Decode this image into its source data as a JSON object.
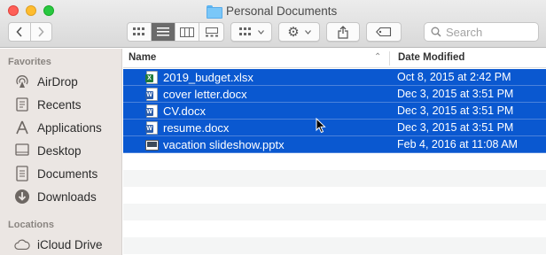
{
  "window": {
    "title": "Personal Documents"
  },
  "toolbar": {
    "back_icon": "chevron-left-icon",
    "forward_icon": "chevron-right-icon",
    "view_modes": [
      "icon-view-icon",
      "list-view-icon",
      "column-view-icon",
      "gallery-view-icon"
    ],
    "active_view": 1,
    "group_icon": "group-by-icon",
    "action_icon": "gear-icon",
    "share_icon": "share-icon",
    "tag_icon": "tag-icon",
    "search_placeholder": "Search"
  },
  "sidebar": {
    "favorites_label": "Favorites",
    "favorites": [
      {
        "label": "AirDrop",
        "icon": "airdrop-icon"
      },
      {
        "label": "Recents",
        "icon": "recents-icon"
      },
      {
        "label": "Applications",
        "icon": "applications-icon"
      },
      {
        "label": "Desktop",
        "icon": "desktop-icon"
      },
      {
        "label": "Documents",
        "icon": "documents-icon"
      },
      {
        "label": "Downloads",
        "icon": "downloads-icon"
      }
    ],
    "locations_label": "Locations",
    "locations": [
      {
        "label": "iCloud Drive",
        "icon": "cloud-icon"
      }
    ]
  },
  "list": {
    "columns": {
      "name": "Name",
      "date": "Date Modified"
    },
    "files": [
      {
        "name": "2019_budget.xlsx",
        "date": "Oct 8, 2015 at 2:42 PM",
        "type": "xlsx",
        "selected": true
      },
      {
        "name": "cover letter.docx",
        "date": "Dec 3, 2015 at 3:51 PM",
        "type": "docx",
        "selected": true
      },
      {
        "name": "CV.docx",
        "date": "Dec 3, 2015 at 3:51 PM",
        "type": "docx",
        "selected": true
      },
      {
        "name": "resume.docx",
        "date": "Dec 3, 2015 at 3:51 PM",
        "type": "docx",
        "selected": true
      },
      {
        "name": "vacation slideshow.pptx",
        "date": "Feb 4, 2016 at 11:08 AM",
        "type": "pptx",
        "selected": true
      }
    ]
  },
  "colors": {
    "selection": "#0a58d0",
    "sidebar_bg": "#ebe6e3"
  }
}
